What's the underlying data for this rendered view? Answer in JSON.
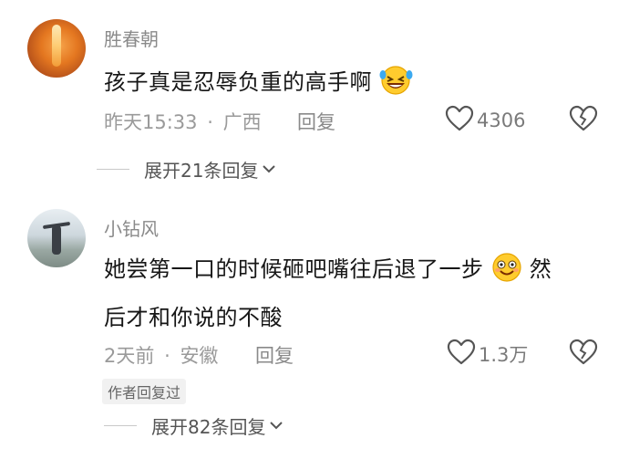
{
  "comments": [
    {
      "username": "胜春朝",
      "text": "孩子真是忍辱负重的高手啊",
      "emoji": "laughing-crying-emoji",
      "date": "昨天15:33",
      "separator": "·",
      "location": "广西",
      "reply_label": "回复",
      "likes": "4306",
      "expand_label": "展开21条回复"
    },
    {
      "username": "小钻风",
      "text_line1": "她尝第一口的时候砸吧嘴往后退了一步",
      "emoji": "smiling-emoji",
      "text_line1_end": "然",
      "text_line2": "后才和你说的不酸",
      "date": "2天前",
      "separator": "·",
      "location": "安徽",
      "reply_label": "回复",
      "likes": "1.3万",
      "badge": "作者回复过",
      "expand_label": "展开82条回复"
    }
  ],
  "icons": {
    "like": "heart-outline-icon",
    "dislike": "broken-heart-icon",
    "expand": "chevron-down-icon"
  }
}
